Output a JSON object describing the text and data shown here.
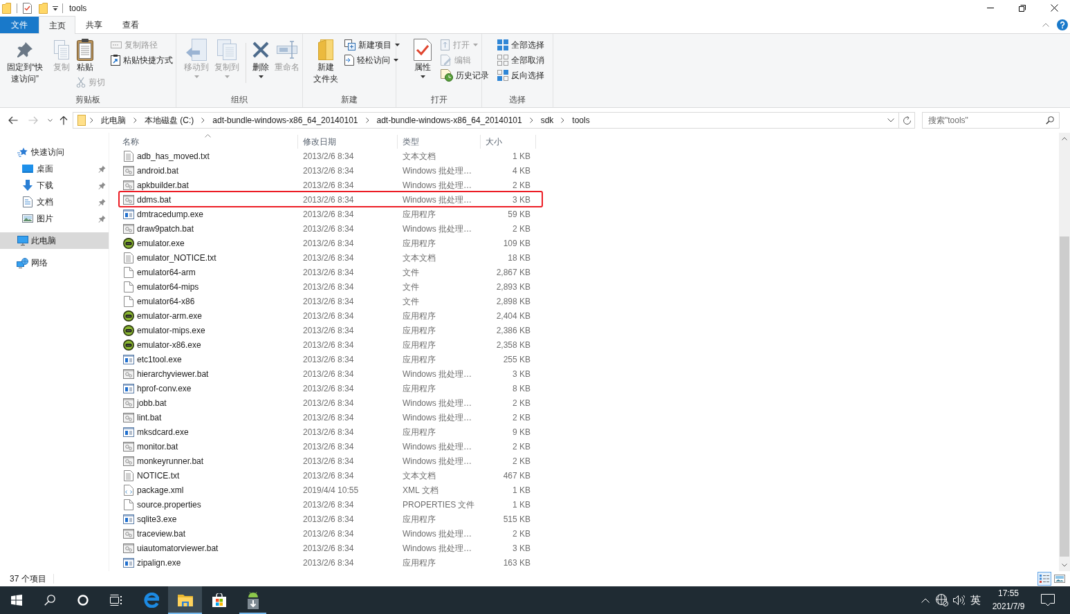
{
  "title_bar": {
    "title": "tools"
  },
  "ribbon": {
    "tabs": [
      {
        "label": "文件",
        "kind": "file",
        "selected": false
      },
      {
        "label": "主页",
        "kind": "tab",
        "selected": true
      },
      {
        "label": "共享",
        "kind": "tab",
        "selected": false
      },
      {
        "label": "查看",
        "kind": "tab",
        "selected": false
      }
    ],
    "groups": [
      {
        "label": "剪贴板",
        "columns": [
          [
            {
              "label": "固定到“快速访问”",
              "kind": "large",
              "disabled": false,
              "dropdown": false
            }
          ],
          [
            {
              "label": "复制",
              "kind": "large",
              "disabled": true,
              "dropdown": false
            }
          ],
          [
            {
              "label": "粘贴",
              "kind": "large",
              "disabled": false,
              "dropdown": false
            },
            {
              "label": "剪切",
              "kind": "small",
              "disabled": true,
              "dropdown": false
            }
          ],
          [
            {
              "label": "复制路径",
              "kind": "small",
              "disabled": true,
              "dropdown": false
            },
            {
              "label": "粘贴快捷方式",
              "kind": "small",
              "disabled": false,
              "dropdown": false
            }
          ]
        ]
      },
      {
        "label": "组织",
        "columns": [
          [
            {
              "label": "移动到",
              "kind": "large",
              "disabled": true,
              "dropdown": true
            }
          ],
          [
            {
              "label": "复制到",
              "kind": "large",
              "disabled": true,
              "dropdown": true
            }
          ],
          [
            {
              "label": "删除",
              "kind": "large",
              "disabled": false,
              "dropdown": true
            }
          ],
          [
            {
              "label": "重命名",
              "kind": "large",
              "disabled": true,
              "dropdown": false
            }
          ]
        ]
      },
      {
        "label": "新建",
        "columns": [
          [
            {
              "label": "新建文件夹",
              "kind": "large",
              "disabled": false,
              "dropdown": false
            }
          ],
          [
            {
              "label": "新建项目",
              "kind": "small",
              "disabled": false,
              "dropdown": true
            },
            {
              "label": "轻松访问",
              "kind": "small",
              "disabled": false,
              "dropdown": true
            }
          ]
        ]
      },
      {
        "label": "打开",
        "columns": [
          [
            {
              "label": "属性",
              "kind": "large",
              "disabled": false,
              "dropdown": true
            }
          ],
          [
            {
              "label": "打开",
              "kind": "small",
              "disabled": true,
              "dropdown": true
            },
            {
              "label": "编辑",
              "kind": "small",
              "disabled": true,
              "dropdown": false
            },
            {
              "label": "历史记录",
              "kind": "small",
              "disabled": false,
              "dropdown": false
            }
          ]
        ]
      },
      {
        "label": "选择",
        "columns": [
          [
            {
              "label": "全部选择",
              "kind": "small",
              "disabled": false,
              "dropdown": false
            },
            {
              "label": "全部取消",
              "kind": "small",
              "disabled": false,
              "dropdown": false
            },
            {
              "label": "反向选择",
              "kind": "small",
              "disabled": false,
              "dropdown": false
            }
          ]
        ]
      }
    ]
  },
  "address_bar": {
    "breadcrumbs": [
      "此电脑",
      "本地磁盘 (C:)",
      "adt-bundle-windows-x86_64_20140101",
      "adt-bundle-windows-x86_64_20140101",
      "sdk",
      "tools"
    ]
  },
  "search": {
    "placeholder": "搜索\"tools\""
  },
  "navigation": [
    {
      "label": "快速访问",
      "kind": "quick-access",
      "selected": false,
      "children": [
        {
          "label": "桌面",
          "kind": "desktop",
          "pinned": true,
          "selected": false
        },
        {
          "label": "下载",
          "kind": "downloads",
          "pinned": true,
          "selected": false
        },
        {
          "label": "文档",
          "kind": "documents",
          "pinned": true,
          "selected": false
        },
        {
          "label": "图片",
          "kind": "pictures",
          "pinned": true,
          "selected": false
        }
      ]
    },
    {
      "label": "此电脑",
      "kind": "computer",
      "selected": true
    },
    {
      "label": "网络",
      "kind": "network",
      "selected": false
    }
  ],
  "file_list": {
    "columns": [
      {
        "label": "名称",
        "sorted": true
      },
      {
        "label": "修改日期",
        "sorted": false
      },
      {
        "label": "类型",
        "sorted": false
      },
      {
        "label": "大小",
        "sorted": false
      }
    ],
    "rows": [
      {
        "name": "adb_has_moved.txt",
        "modified": "2013/2/6 8:34",
        "type": "文本文档",
        "size": "1 KB",
        "kind": "text",
        "highlighted": false
      },
      {
        "name": "android.bat",
        "modified": "2013/2/6 8:34",
        "type": "Windows 批处理…",
        "size": "4 KB",
        "kind": "batch",
        "highlighted": false
      },
      {
        "name": "apkbuilder.bat",
        "modified": "2013/2/6 8:34",
        "type": "Windows 批处理…",
        "size": "2 KB",
        "kind": "batch",
        "highlighted": false
      },
      {
        "name": "ddms.bat",
        "modified": "2013/2/6 8:34",
        "type": "Windows 批处理…",
        "size": "3 KB",
        "kind": "batch",
        "highlighted": true
      },
      {
        "name": "dmtracedump.exe",
        "modified": "2013/2/6 8:34",
        "type": "应用程序",
        "size": "59 KB",
        "kind": "program",
        "highlighted": false
      },
      {
        "name": "draw9patch.bat",
        "modified": "2013/2/6 8:34",
        "type": "Windows 批处理…",
        "size": "2 KB",
        "kind": "batch",
        "highlighted": false
      },
      {
        "name": "emulator.exe",
        "modified": "2013/2/6 8:34",
        "type": "应用程序",
        "size": "109 KB",
        "kind": "emulator",
        "highlighted": false
      },
      {
        "name": "emulator_NOTICE.txt",
        "modified": "2013/2/6 8:34",
        "type": "文本文档",
        "size": "18 KB",
        "kind": "text",
        "highlighted": false
      },
      {
        "name": "emulator64-arm",
        "modified": "2013/2/6 8:34",
        "type": "文件",
        "size": "2,867 KB",
        "kind": "file",
        "highlighted": false
      },
      {
        "name": "emulator64-mips",
        "modified": "2013/2/6 8:34",
        "type": "文件",
        "size": "2,893 KB",
        "kind": "file",
        "highlighted": false
      },
      {
        "name": "emulator64-x86",
        "modified": "2013/2/6 8:34",
        "type": "文件",
        "size": "2,898 KB",
        "kind": "file",
        "highlighted": false
      },
      {
        "name": "emulator-arm.exe",
        "modified": "2013/2/6 8:34",
        "type": "应用程序",
        "size": "2,404 KB",
        "kind": "emulator",
        "highlighted": false
      },
      {
        "name": "emulator-mips.exe",
        "modified": "2013/2/6 8:34",
        "type": "应用程序",
        "size": "2,386 KB",
        "kind": "emulator",
        "highlighted": false
      },
      {
        "name": "emulator-x86.exe",
        "modified": "2013/2/6 8:34",
        "type": "应用程序",
        "size": "2,358 KB",
        "kind": "emulator",
        "highlighted": false
      },
      {
        "name": "etc1tool.exe",
        "modified": "2013/2/6 8:34",
        "type": "应用程序",
        "size": "255 KB",
        "kind": "program",
        "highlighted": false
      },
      {
        "name": "hierarchyviewer.bat",
        "modified": "2013/2/6 8:34",
        "type": "Windows 批处理…",
        "size": "3 KB",
        "kind": "batch",
        "highlighted": false
      },
      {
        "name": "hprof-conv.exe",
        "modified": "2013/2/6 8:34",
        "type": "应用程序",
        "size": "8 KB",
        "kind": "program",
        "highlighted": false
      },
      {
        "name": "jobb.bat",
        "modified": "2013/2/6 8:34",
        "type": "Windows 批处理…",
        "size": "2 KB",
        "kind": "batch",
        "highlighted": false
      },
      {
        "name": "lint.bat",
        "modified": "2013/2/6 8:34",
        "type": "Windows 批处理…",
        "size": "2 KB",
        "kind": "batch",
        "highlighted": false
      },
      {
        "name": "mksdcard.exe",
        "modified": "2013/2/6 8:34",
        "type": "应用程序",
        "size": "9 KB",
        "kind": "program",
        "highlighted": false
      },
      {
        "name": "monitor.bat",
        "modified": "2013/2/6 8:34",
        "type": "Windows 批处理…",
        "size": "2 KB",
        "kind": "batch",
        "highlighted": false
      },
      {
        "name": "monkeyrunner.bat",
        "modified": "2013/2/6 8:34",
        "type": "Windows 批处理…",
        "size": "2 KB",
        "kind": "batch",
        "highlighted": false
      },
      {
        "name": "NOTICE.txt",
        "modified": "2013/2/6 8:34",
        "type": "文本文档",
        "size": "467 KB",
        "kind": "text",
        "highlighted": false
      },
      {
        "name": "package.xml",
        "modified": "2019/4/4 10:55",
        "type": "XML 文档",
        "size": "1 KB",
        "kind": "xml",
        "highlighted": false
      },
      {
        "name": "source.properties",
        "modified": "2013/2/6 8:34",
        "type": "PROPERTIES 文件",
        "size": "1 KB",
        "kind": "file",
        "highlighted": false
      },
      {
        "name": "sqlite3.exe",
        "modified": "2013/2/6 8:34",
        "type": "应用程序",
        "size": "515 KB",
        "kind": "program",
        "highlighted": false
      },
      {
        "name": "traceview.bat",
        "modified": "2013/2/6 8:34",
        "type": "Windows 批处理…",
        "size": "2 KB",
        "kind": "batch",
        "highlighted": false
      },
      {
        "name": "uiautomatorviewer.bat",
        "modified": "2013/2/6 8:34",
        "type": "Windows 批处理…",
        "size": "3 KB",
        "kind": "batch",
        "highlighted": false
      },
      {
        "name": "zipalign.exe",
        "modified": "2013/2/6 8:34",
        "type": "应用程序",
        "size": "163 KB",
        "kind": "program",
        "highlighted": false
      }
    ]
  },
  "status_bar": {
    "item_count": "37 个项目",
    "views": [
      {
        "kind": "details",
        "selected": true
      },
      {
        "kind": "thumbnails",
        "selected": false
      }
    ]
  },
  "taskbar": {
    "apps": [
      {
        "kind": "edge",
        "active": false,
        "running": false
      },
      {
        "kind": "explorer",
        "active": true,
        "running": true
      },
      {
        "kind": "store",
        "active": false,
        "running": false
      },
      {
        "kind": "android",
        "active": false,
        "running": true
      }
    ],
    "tray": {
      "ime": "英",
      "time": "17:55",
      "date": "2021/7/9"
    }
  }
}
